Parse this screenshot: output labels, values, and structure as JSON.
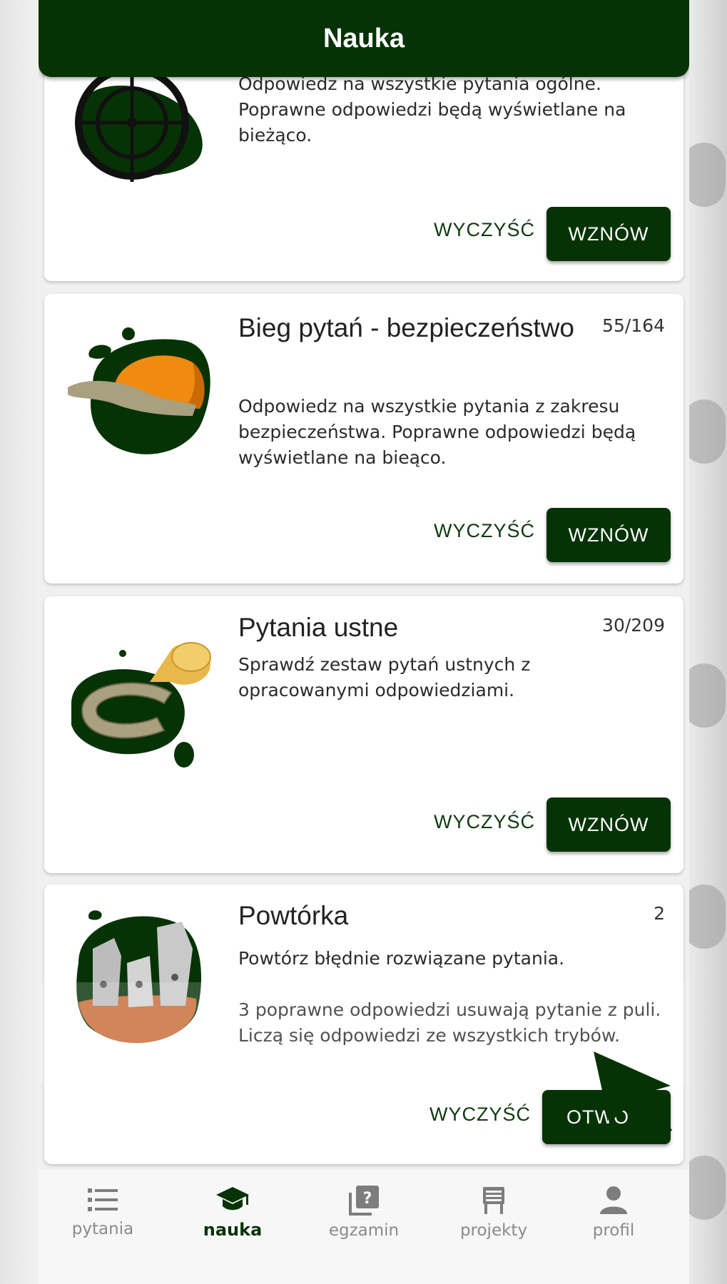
{
  "app": {
    "title": "Nauka"
  },
  "cards": [
    {
      "description": "Odpowiedz na wszystkie pytania ogólne. Poprawne odpowiedzi będą wyświetlane na bieżąco.",
      "clear_label": "WYCZYŚĆ",
      "action_label": "WZNÓW"
    },
    {
      "title": "Bieg pytań - bezpieczeństwo",
      "count": "55/164",
      "description": "Odpowiedz na wszystkie pytania z zakresu bezpieczeństwa. Poprawne odpowiedzi będą wyświetlane na bieąco.",
      "clear_label": "WYCZYŚĆ",
      "action_label": "WZNÓW"
    },
    {
      "title": "Pytania ustne",
      "count": "30/209",
      "description": "Sprawdź zestaw pytań ustnych z opracowanymi odpowiedziami.",
      "clear_label": "WYCZYŚĆ",
      "action_label": "WZNÓW"
    },
    {
      "title": "Powtórka",
      "count": "2",
      "description": "Powtórz błędnie rozwiązane pytania.",
      "description2": "3 poprawne odpowiedzi usuwają pytanie z puli. Liczą się odpowiedzi ze wszystkich trybów.",
      "clear_label": "WYCZYŚĆ",
      "action_label": "OTWÓ"
    }
  ],
  "nav": [
    {
      "label": "pytania",
      "icon": "list-icon",
      "active": false
    },
    {
      "label": "nauka",
      "icon": "graduation-cap-icon",
      "active": true
    },
    {
      "label": "egzamin",
      "icon": "question-box-icon",
      "active": false
    },
    {
      "label": "projekty",
      "icon": "clipboard-icon",
      "active": false
    },
    {
      "label": "profil",
      "icon": "person-icon",
      "active": false
    }
  ],
  "colors": {
    "primary": "#063306",
    "orange": "#f08a10",
    "background": "#f0f0f0"
  }
}
